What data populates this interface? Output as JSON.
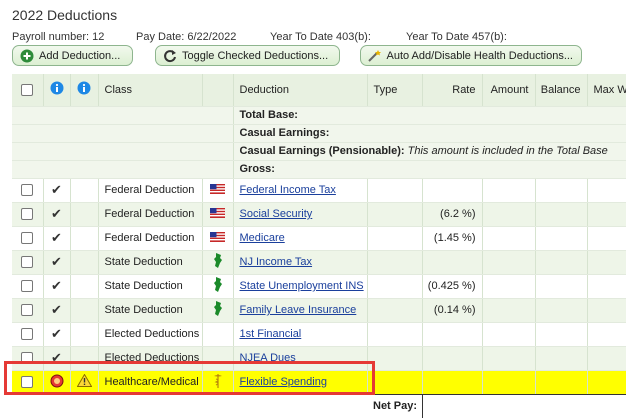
{
  "page": {
    "title": "2022 Deductions",
    "payroll_number_label": "Payroll number:",
    "payroll_number": "12",
    "pay_date_label": "Pay Date:",
    "pay_date": "6/22/2022",
    "ytd_403b": "Year To Date 403(b):",
    "ytd_457b": "Year To Date 457(b):"
  },
  "toolbar": {
    "add_label": "Add Deduction...",
    "toggle_label": "Toggle Checked Deductions...",
    "auto_label": "Auto Add/Disable Health Deductions..."
  },
  "table": {
    "headers": {
      "class": "Class",
      "deduction": "Deduction",
      "type": "Type",
      "rate": "Rate",
      "amount": "Amount",
      "balance": "Balance",
      "max": "Max W"
    },
    "summary": {
      "total_base": "Total Base:",
      "casual_earnings": "Casual Earnings:",
      "casual_pension": "Casual Earnings (Pensionable):",
      "casual_pension_note": "This amount is included in the Total Base",
      "gross": "Gross:"
    },
    "rows": [
      {
        "class": "Federal Deduction",
        "name": "Federal Income Tax",
        "rate": "",
        "flag": "us-flag-icon"
      },
      {
        "class": "Federal Deduction",
        "name": "Social Security",
        "rate": "(6.2 %)",
        "flag": "us-flag-icon"
      },
      {
        "class": "Federal Deduction",
        "name": "Medicare",
        "rate": "(1.45 %)",
        "flag": "us-flag-icon"
      },
      {
        "class": "State Deduction",
        "name": "NJ Income Tax",
        "rate": "",
        "flag": "nj-state-icon"
      },
      {
        "class": "State Deduction",
        "name": "State Unemployment INS",
        "rate": "(0.425 %)",
        "flag": "nj-state-icon"
      },
      {
        "class": "State Deduction",
        "name": "Family Leave Insurance",
        "rate": "(0.14 %)",
        "flag": "nj-state-icon"
      },
      {
        "class": "Elected Deductions",
        "name": "1st Financial",
        "rate": ""
      },
      {
        "class": "Elected Deductions",
        "name": "NJEA Dues",
        "rate": ""
      },
      {
        "class": "Healthcare/Medical",
        "name": "Flexible Spending",
        "rate": "",
        "highlighted": true
      }
    ],
    "net_pay_label": "Net Pay:"
  },
  "colors": {
    "row_alt": "#eef5e8",
    "highlight_row": "#ffff00",
    "annotation_box": "#e53935",
    "link": "#1a3f9c"
  }
}
